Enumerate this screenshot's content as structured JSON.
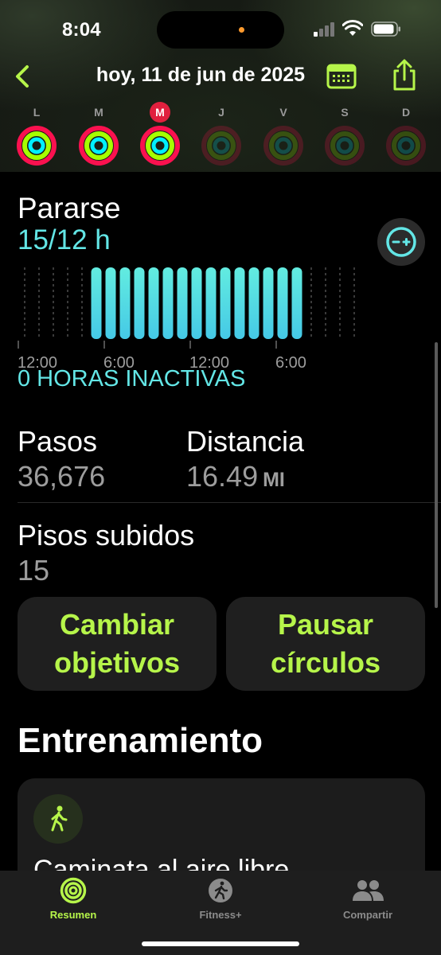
{
  "status_bar": {
    "time": "8:04"
  },
  "nav": {
    "title": "hoy, 11 de jun de 2025",
    "back_icon": "chevron-left-icon",
    "calendar_icon": "calendar-icon",
    "share_icon": "share-icon"
  },
  "week": {
    "days": [
      {
        "letter": "L",
        "state": "closed"
      },
      {
        "letter": "M",
        "state": "closed"
      },
      {
        "letter": "M",
        "state": "current"
      },
      {
        "letter": "J",
        "state": "future"
      },
      {
        "letter": "V",
        "state": "future"
      },
      {
        "letter": "S",
        "state": "future"
      },
      {
        "letter": "D",
        "state": "future"
      }
    ]
  },
  "stand": {
    "title": "Pararse",
    "value": "15/12 h",
    "inactive_label": "0 HORAS INACTIVAS",
    "toggle_icon": "chart-toggle-icon",
    "chart_data": {
      "type": "bar",
      "x_tick_labels": [
        "12:00",
        "6:00",
        "12:00",
        "6:00"
      ],
      "hours_total": 24,
      "stood_hours": [
        5,
        6,
        7,
        8,
        9,
        10,
        11,
        12,
        13,
        14,
        15,
        16,
        17,
        18,
        19
      ],
      "bar_color": "#5fe6e0"
    }
  },
  "steps": {
    "label": "Pasos",
    "value": "36,676"
  },
  "distance": {
    "label": "Distancia",
    "value": "16.49",
    "unit": "MI"
  },
  "floors": {
    "label": "Pisos subidos",
    "value": "15"
  },
  "buttons": {
    "change_goals_line1": "Cambiar",
    "change_goals_line2": "objetivos",
    "pause_rings_line1": "Pausar",
    "pause_rings_line2": "círculos"
  },
  "workouts": {
    "title": "Entrenamiento",
    "item_name": "Caminata al aire libre",
    "item_icon": "walking-figure-icon"
  },
  "tabs": [
    {
      "label": "Resumen",
      "icon": "activity-rings-icon",
      "active": true
    },
    {
      "label": "Fitness+",
      "icon": "fitness-plus-icon",
      "active": false
    },
    {
      "label": "Compartir",
      "icon": "people-icon",
      "active": false
    }
  ],
  "colors": {
    "move": "#fa114f",
    "exercise": "#a6ff00",
    "stand": "#00f0ff",
    "accent": "#b6f54a",
    "stand_text": "#63e6e6",
    "today_badge": "#e0203e"
  }
}
